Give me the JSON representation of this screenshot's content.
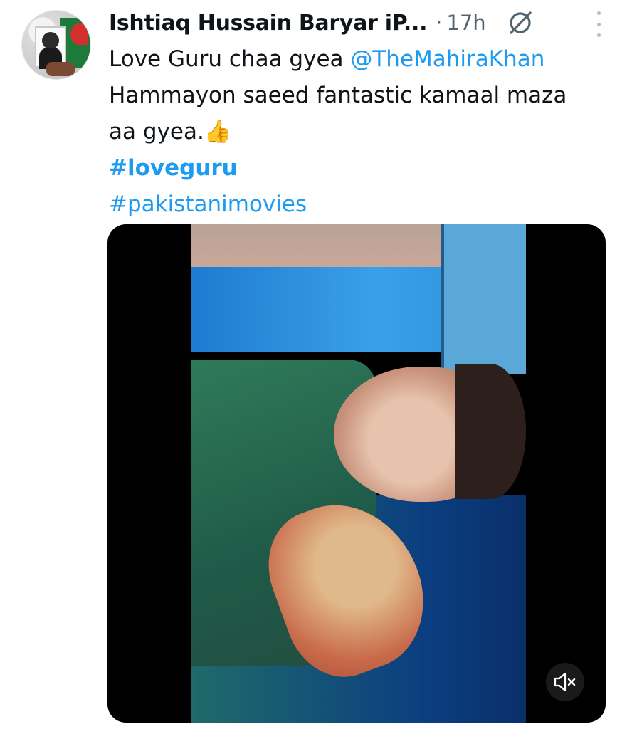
{
  "tweet": {
    "author_name": "Ishtiaq Hussain Baryar iP...",
    "separator": "·",
    "timestamp": "17h",
    "text_line_1_prefix": "Love Guru chaa gyea ",
    "mention": "@TheMahiraKhan",
    "text_line_2": "Hammayon saeed fantastic kamaal maza",
    "text_line_3": "aa gyea.👍",
    "hashtag_1": "#loveguru",
    "hashtag_2": "#pakistanimovies"
  },
  "icons": {
    "grok": "grok-icon",
    "more": "more-options-icon",
    "mute": "volume-muted-icon"
  },
  "colors": {
    "link": "#1d9bf0",
    "text": "#0f1419",
    "muted": "#536471"
  }
}
